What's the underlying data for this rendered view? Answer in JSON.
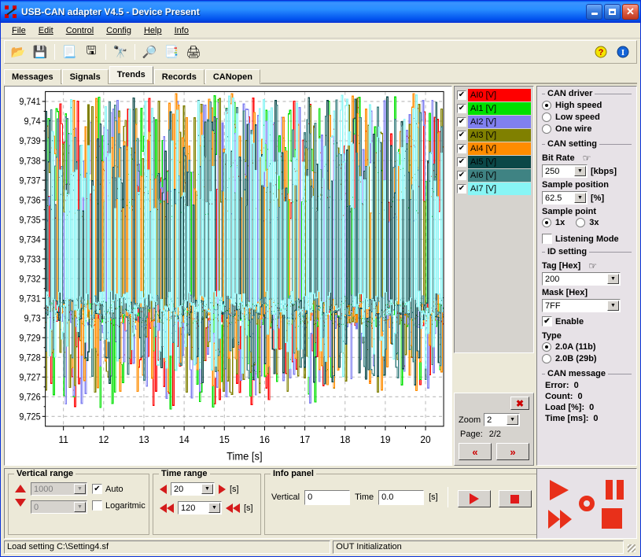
{
  "window": {
    "title": "USB-CAN adapter  V4.5  -  Device Present",
    "minimize_label": "",
    "maximize_label": "",
    "close_label": "✕"
  },
  "menu": [
    {
      "label": "File"
    },
    {
      "label": "Edit"
    },
    {
      "label": "Control"
    },
    {
      "label": "Config"
    },
    {
      "label": "Help"
    },
    {
      "label": "Info"
    }
  ],
  "toolbar": {
    "buttons": [
      {
        "name": "open-icon",
        "glyph": "📂"
      },
      {
        "name": "save-icon",
        "glyph": "💾"
      },
      {
        "name": "print-preview-icon",
        "glyph": "📃"
      },
      {
        "name": "save-as-icon",
        "glyph": "🖫"
      },
      {
        "name": "find-icon",
        "glyph": "🔭"
      },
      {
        "name": "inspect-icon",
        "glyph": "🔎"
      },
      {
        "name": "copy-icon",
        "glyph": "📑"
      },
      {
        "name": "print-icon",
        "glyph": "🖨"
      }
    ],
    "help_glyph": "?",
    "info_glyph": "i"
  },
  "tabs": [
    {
      "label": "Messages",
      "active": false
    },
    {
      "label": "Signals",
      "active": false
    },
    {
      "label": "Trends",
      "active": true
    },
    {
      "label": "Records",
      "active": false
    },
    {
      "label": "CANopen",
      "active": false
    }
  ],
  "chart_data": {
    "type": "line",
    "title": "",
    "xlabel": "Time [s]",
    "ylabel": "",
    "xlim": [
      10.55,
      20.45
    ],
    "ylim": [
      9.7245,
      9.7415
    ],
    "xticks": [
      11,
      12,
      13,
      14,
      15,
      16,
      17,
      18,
      19,
      20
    ],
    "xticklabels": [
      "11",
      "12",
      "13",
      "14",
      "15",
      "16",
      "17",
      "18",
      "19",
      "20"
    ],
    "yticks": [
      9.725,
      9.726,
      9.727,
      9.728,
      9.729,
      9.73,
      9.731,
      9.732,
      9.733,
      9.734,
      9.735,
      9.736,
      9.737,
      9.738,
      9.739,
      9.74,
      9.741
    ],
    "yticklabels": [
      "9,725",
      "9,726",
      "9,727",
      "9,728",
      "9,729",
      "9,73",
      "9,731",
      "9,732",
      "9,733",
      "9,734",
      "9,735",
      "9,736",
      "9,737",
      "9,738",
      "9,739",
      "9,74",
      "9,741"
    ],
    "grid": true,
    "grid_style": "dashed",
    "grid_color": "#808080",
    "legend_position": "right-outside",
    "baseline": 9.7299,
    "series": [
      {
        "name": "AI0 [V]",
        "color": "#ff0000",
        "baseline": 9.73,
        "spike_low": 9.7252,
        "spike_high": 9.7412
      },
      {
        "name": "AI1 [V]",
        "color": "#00e000",
        "baseline": 9.7301,
        "spike_low": 9.7253,
        "spike_high": 9.7413
      },
      {
        "name": "AI2 [V]",
        "color": "#8080f0",
        "baseline": 9.7297,
        "spike_low": 9.7256,
        "spike_high": 9.7411
      },
      {
        "name": "AI3 [V]",
        "color": "#808000",
        "baseline": 9.7302,
        "spike_low": 9.726,
        "spike_high": 9.7412
      },
      {
        "name": "AI4 [V]",
        "color": "#ff8c00",
        "baseline": 9.7303,
        "spike_low": 9.7262,
        "spike_high": 9.7414
      },
      {
        "name": "AI5 [V]",
        "color": "#0b4848",
        "baseline": 9.7304,
        "spike_low": 9.7265,
        "spike_high": 9.7413
      },
      {
        "name": "AI6 [V]",
        "color": "#3f8383",
        "baseline": 9.7305,
        "spike_low": 9.7268,
        "spike_high": 9.7412
      },
      {
        "name": "AI7 [V]",
        "color": "#88f5f5",
        "baseline": 9.7307,
        "spike_low": 9.727,
        "spike_high": 9.7414
      }
    ]
  },
  "legend": {
    "items": [
      {
        "label": "AI0 [V]",
        "color": "#ff0000",
        "checked": true,
        "text_color": "#000000"
      },
      {
        "label": "AI1 [V]",
        "color": "#00e000",
        "checked": true,
        "text_color": "#000000"
      },
      {
        "label": "AI2 [V]",
        "color": "#8080f0",
        "checked": true,
        "text_color": "#000000"
      },
      {
        "label": "AI3 [V]",
        "color": "#808000",
        "checked": true,
        "text_color": "#000000"
      },
      {
        "label": "AI4 [V]",
        "color": "#ff8c00",
        "checked": true,
        "text_color": "#000000"
      },
      {
        "label": "AI5 [V]",
        "color": "#0b4848",
        "checked": true,
        "text_color": "#000000"
      },
      {
        "label": "AI6 [V]",
        "color": "#3f8383",
        "checked": true,
        "text_color": "#000000"
      },
      {
        "label": "AI7 [V]",
        "color": "#88f5f5",
        "checked": true,
        "text_color": "#000000"
      }
    ],
    "check_glyph": "✔"
  },
  "zoom_panel": {
    "close_glyph": "✖",
    "zoom_label": "Zoom",
    "zoom_value": "2",
    "page_label": "Page:",
    "page_value": "2/2",
    "prev_label": "«",
    "next_label": "»"
  },
  "vertical_range": {
    "title": "Vertical range",
    "max_value": "1000",
    "min_value": "0",
    "auto_label": "Auto",
    "auto_checked": true,
    "log_label": "Logaritmic",
    "log_checked": false,
    "check_glyph": "✔"
  },
  "time_range": {
    "title": "Time range",
    "span_value": "20",
    "span_unit": "[s]",
    "total_value": "120",
    "total_unit": "[s]"
  },
  "info_panel": {
    "title": "Info panel",
    "vertical_label": "Vertical",
    "vertical_value": "0",
    "time_label": "Time",
    "time_value": "0.0",
    "time_unit": "[s]"
  },
  "can_driver": {
    "title": "CAN driver",
    "options": [
      {
        "label": "High speed",
        "selected": true
      },
      {
        "label": "Low speed",
        "selected": false
      },
      {
        "label": "One wire",
        "selected": false
      }
    ]
  },
  "can_setting": {
    "title": "CAN setting",
    "bit_rate_label": "Bit Rate",
    "bit_rate_value": "250",
    "bit_rate_unit": "[kbps]",
    "sample_position_label": "Sample position",
    "sample_position_value": "62.5",
    "sample_position_unit": "[%]",
    "sample_point_label": "Sample point",
    "sample_point_options": [
      {
        "label": "1x",
        "selected": true
      },
      {
        "label": "3x",
        "selected": false
      }
    ],
    "listening_mode_label": "Listening Mode",
    "listening_mode_checked": false
  },
  "id_setting": {
    "title": "ID setting",
    "tag_label": "Tag [Hex]",
    "tag_value": "200",
    "mask_label": "Mask [Hex]",
    "mask_value": "7FF",
    "enable_label": "Enable",
    "enable_checked": true,
    "check_glyph": "✔",
    "type_label": "Type",
    "type_options": [
      {
        "label": "2.0A (11b)",
        "selected": true
      },
      {
        "label": "2.0B (29b)",
        "selected": false
      }
    ]
  },
  "can_message": {
    "title": "CAN message",
    "rows": [
      {
        "label": "Error:",
        "value": "0"
      },
      {
        "label": "Count:",
        "value": "0"
      },
      {
        "label": "Load [%]:",
        "value": "0"
      },
      {
        "label": "Time [ms]:",
        "value": "0"
      }
    ]
  },
  "statusbar": {
    "left": "Load setting C:\\Setting4.sf",
    "right": "OUT Initialization"
  }
}
